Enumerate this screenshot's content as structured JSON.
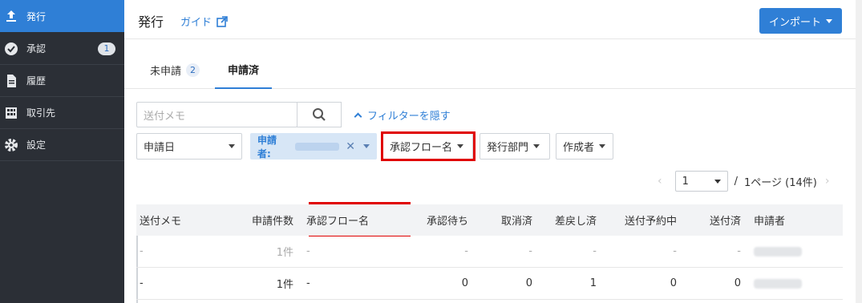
{
  "sidebar": {
    "items": [
      {
        "label": "発行",
        "icon": "upload-icon",
        "active": true
      },
      {
        "label": "承認",
        "icon": "check-circle-icon",
        "badge": "1"
      },
      {
        "label": "履歴",
        "icon": "document-icon"
      },
      {
        "label": "取引先",
        "icon": "building-icon"
      },
      {
        "label": "設定",
        "icon": "gear-icon"
      }
    ]
  },
  "header": {
    "title": "発行",
    "guide_label": "ガイド",
    "import_label": "インポート"
  },
  "tabs": [
    {
      "label": "未申請",
      "count": "2"
    },
    {
      "label": "申請済"
    }
  ],
  "search": {
    "placeholder": "送付メモ",
    "filter_toggle_label": "フィルターを隠す"
  },
  "filters": {
    "date_label": "申請日",
    "applicant_label": "申請者:",
    "flow_label": "承認フロー名",
    "dept_label": "発行部門",
    "creator_label": "作成者"
  },
  "pager": {
    "current_page": "1",
    "separator": "/",
    "total_label": "1ページ (14件)"
  },
  "table": {
    "columns": [
      "送付メモ",
      "申請件数",
      "承認フロー名",
      "承認待ち",
      "取消済",
      "差戻し済",
      "送付予約中",
      "送付済",
      "申請者"
    ],
    "rows": [
      [
        "-",
        "1件",
        "-",
        "-",
        "-",
        "-",
        "-",
        "-",
        ""
      ],
      [
        "-",
        "1件",
        "-",
        "0",
        "0",
        "1",
        "0",
        "0",
        ""
      ]
    ]
  },
  "colors": {
    "accent": "#2f7fd6",
    "sidebar_bg": "#2b2f36",
    "highlight": "#e00000"
  }
}
